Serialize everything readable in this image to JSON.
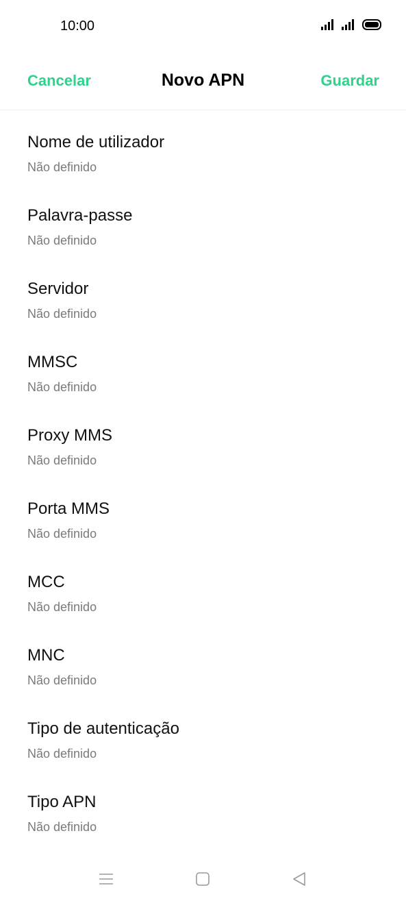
{
  "status_bar": {
    "time": "10:00",
    "icons": [
      "signal-icon",
      "signal-icon",
      "battery-icon"
    ]
  },
  "header": {
    "cancel_label": "Cancelar",
    "title": "Novo APN",
    "save_label": "Guardar",
    "accent_color": "#2fd28a"
  },
  "fields": [
    {
      "label": "Nome de utilizador",
      "value": "Não definido"
    },
    {
      "label": "Palavra-passe",
      "value": "Não definido"
    },
    {
      "label": "Servidor",
      "value": "Não definido"
    },
    {
      "label": "MMSC",
      "value": "Não definido"
    },
    {
      "label": "Proxy MMS",
      "value": "Não definido"
    },
    {
      "label": "Porta MMS",
      "value": "Não definido"
    },
    {
      "label": "MCC",
      "value": "Não definido"
    },
    {
      "label": "MNC",
      "value": "Não definido"
    },
    {
      "label": "Tipo de autenticação",
      "value": "Não definido"
    },
    {
      "label": "Tipo APN",
      "value": "Não definido"
    }
  ],
  "nav_bar": {
    "icons": [
      "menu-icon",
      "home-icon",
      "back-icon"
    ]
  }
}
